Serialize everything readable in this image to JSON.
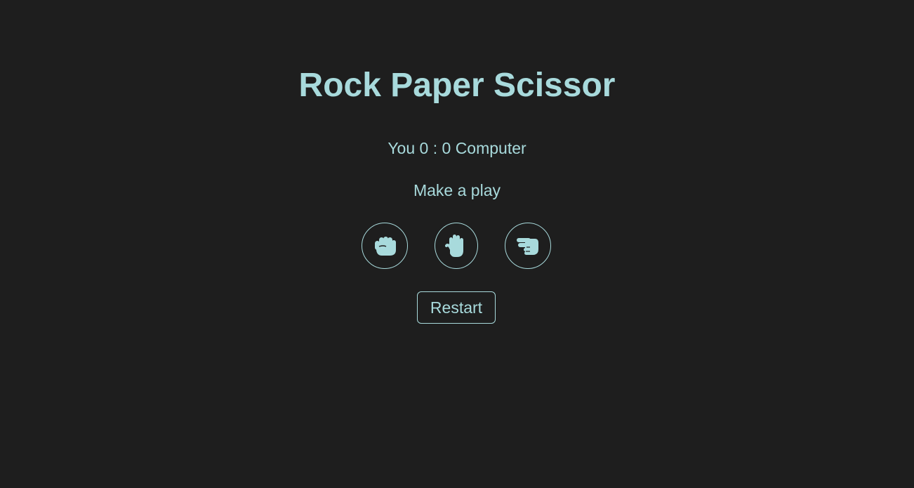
{
  "game": {
    "title": "Rock Paper Scissor",
    "score": {
      "player_label": "You",
      "player_score": "0",
      "separator": ":",
      "computer_score": "0",
      "computer_label": "Computer"
    },
    "message": "Make a play",
    "choices": [
      {
        "name": "rock",
        "icon": "hand-rock-icon"
      },
      {
        "name": "paper",
        "icon": "hand-paper-icon"
      },
      {
        "name": "scissors",
        "icon": "hand-scissors-icon"
      }
    ],
    "restart_label": "Restart"
  },
  "colors": {
    "background": "#1e1e1e",
    "accent": "#a8dadc"
  }
}
